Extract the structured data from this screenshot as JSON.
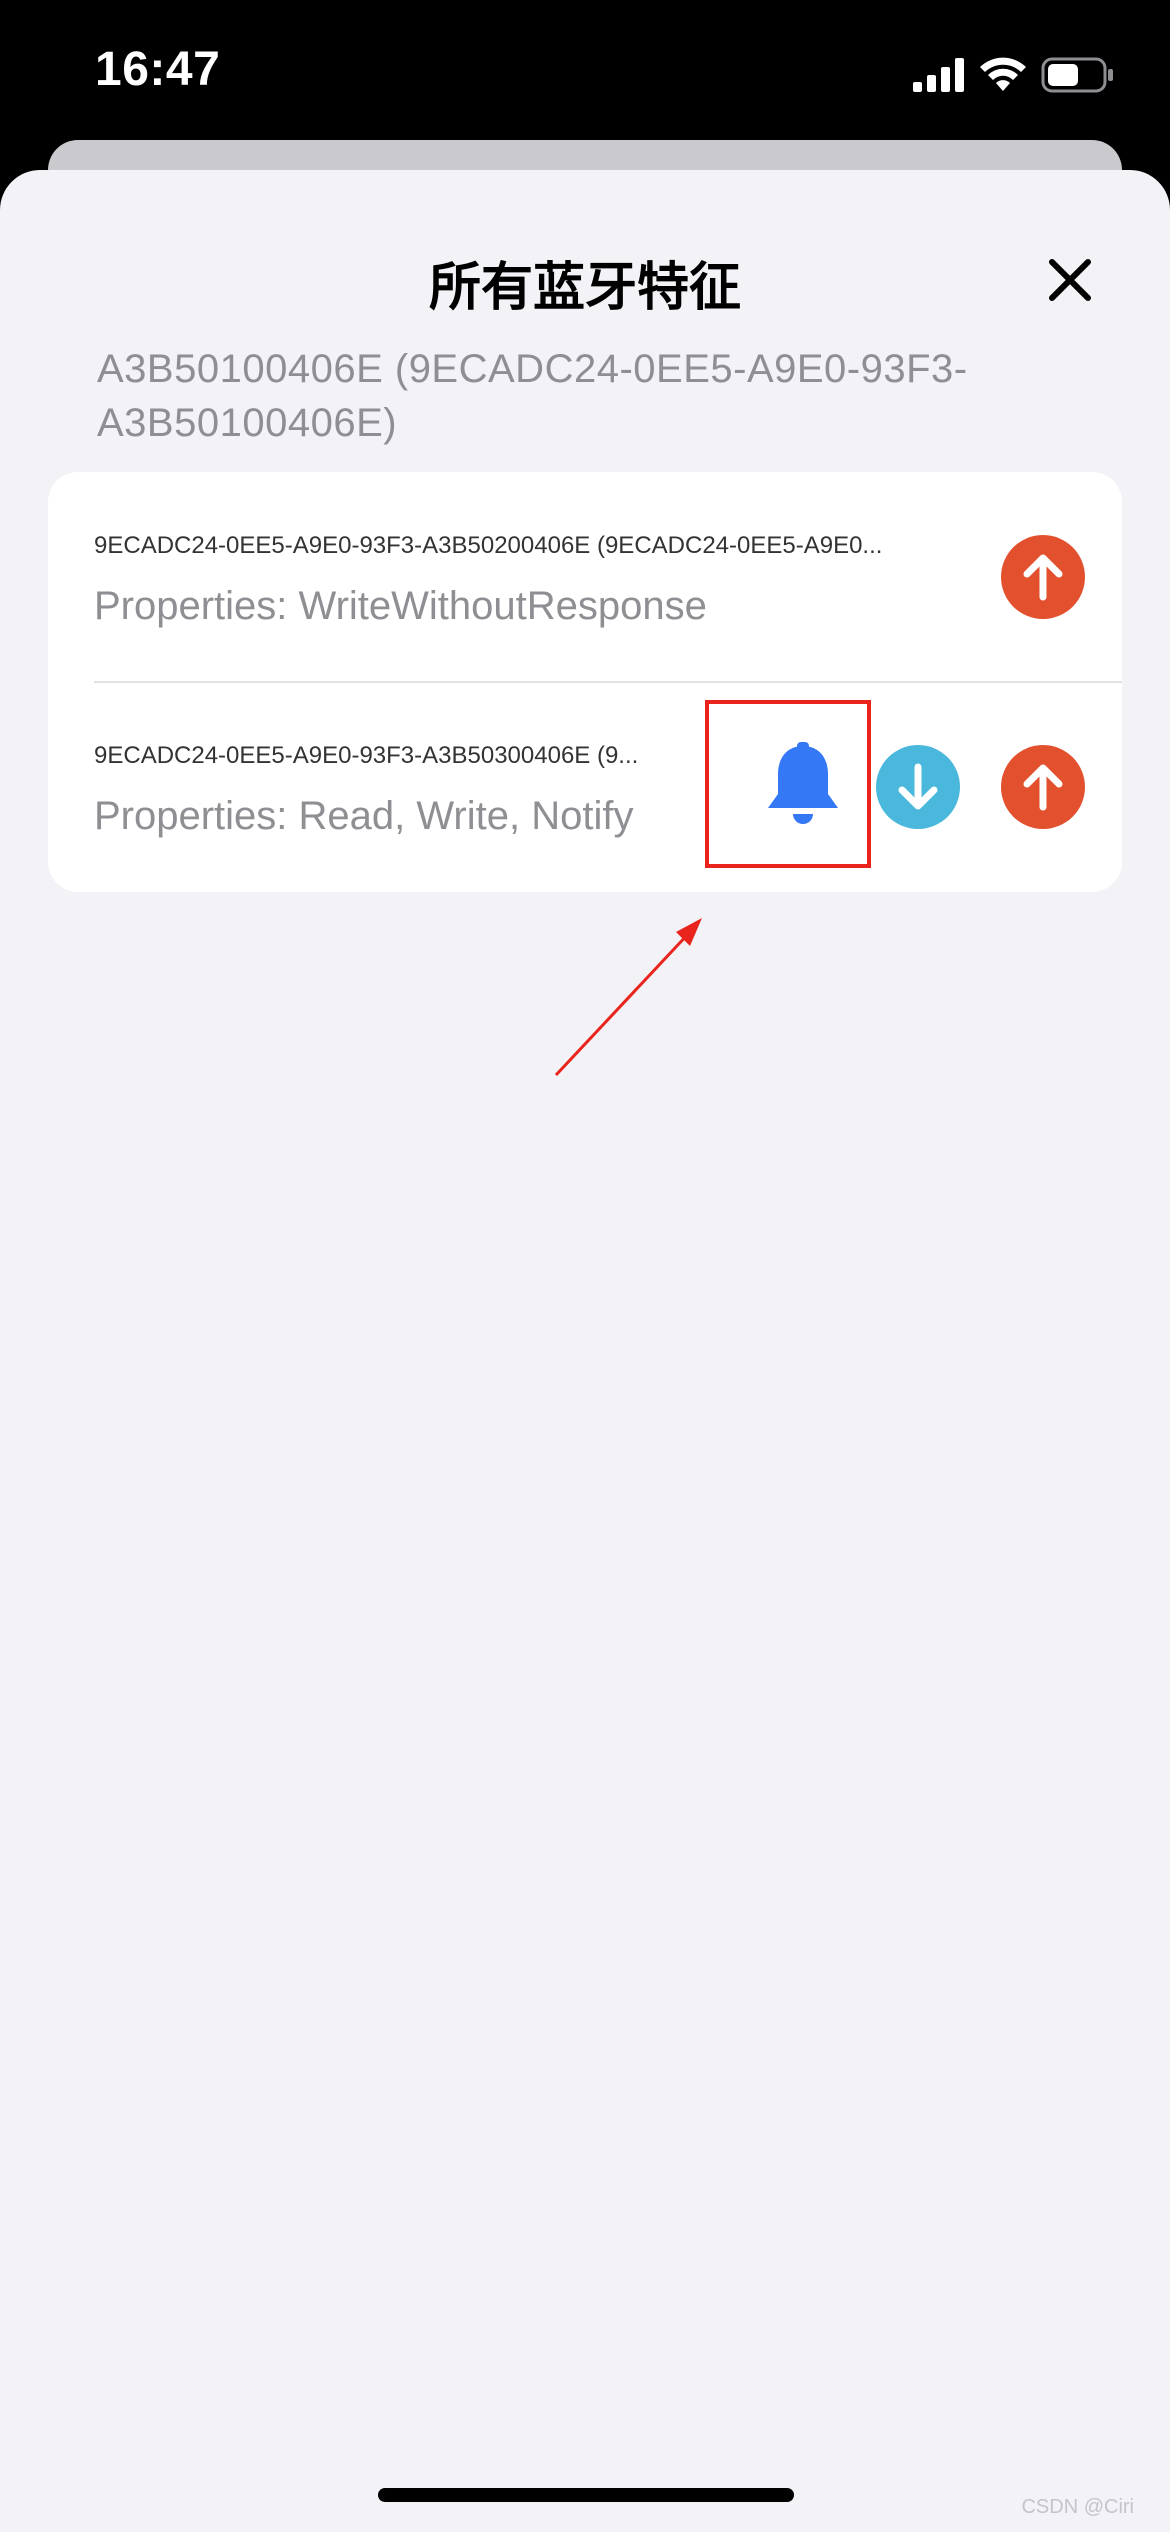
{
  "status_bar": {
    "time": "16:47"
  },
  "sheet": {
    "title": "所有蓝牙特征",
    "service_subtitle": "A3B50100406E (9ECADC24-0EE5-A9E0-93F3-A3B50100406E)"
  },
  "characteristics": [
    {
      "uuid": "9ECADC24-0EE5-A9E0-93F3-A3B50200406E (9ECADC24-0EE5-A9E0...",
      "properties": "Properties: WriteWithoutResponse",
      "actions": [
        "write"
      ]
    },
    {
      "uuid": "9ECADC24-0EE5-A9E0-93F3-A3B50300406E (9...",
      "properties": "Properties: Read, Write, Notify",
      "actions": [
        "notify",
        "read",
        "write"
      ]
    }
  ],
  "colors": {
    "write_button": "#e2502e",
    "read_button": "#4ab7dc",
    "notify_bell": "#3478f6",
    "annotation": "#e8241c",
    "sheet_background": "#f2f2f7"
  },
  "icons": {
    "close": "close-icon",
    "write": "arrow-up-icon",
    "read": "arrow-down-icon",
    "notify": "bell-icon"
  },
  "watermark": "CSDN @Ciri"
}
